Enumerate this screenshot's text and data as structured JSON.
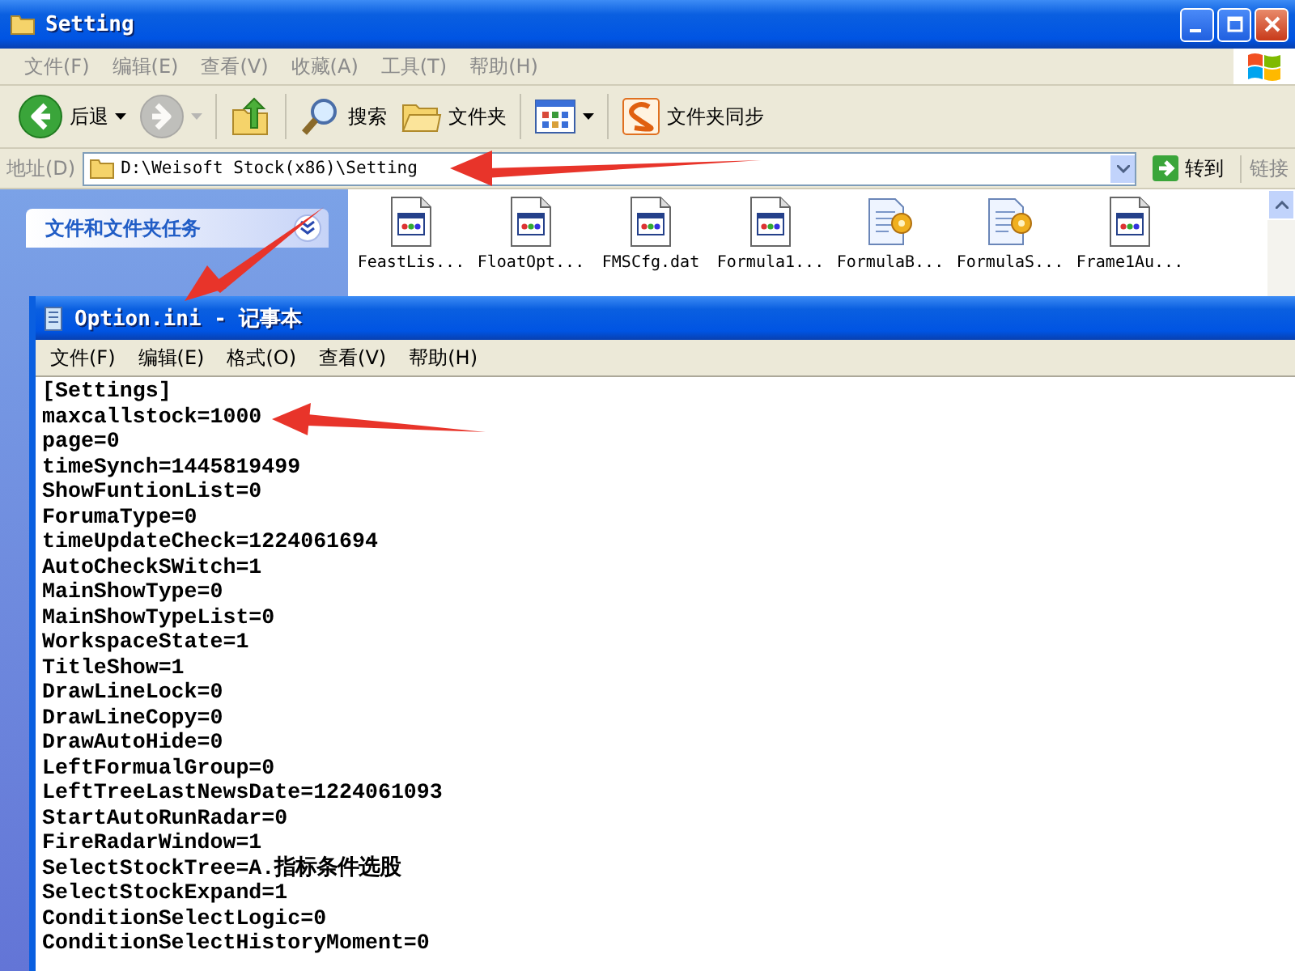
{
  "explorer": {
    "title": "Setting",
    "menu": [
      "文件(F)",
      "编辑(E)",
      "查看(V)",
      "收藏(A)",
      "工具(T)",
      "帮助(H)"
    ],
    "toolbar": [
      {
        "kind": "back",
        "label": "后退",
        "disabled": false,
        "dropdown": true
      },
      {
        "kind": "forward",
        "disabled": true,
        "dropdown": true
      },
      {
        "kind": "up",
        "disabled": false,
        "dropdown": false
      },
      {
        "kind": "search",
        "label": "搜索",
        "disabled": false,
        "dropdown": false
      },
      {
        "kind": "folders",
        "label": "文件夹",
        "disabled": false,
        "dropdown": false
      },
      {
        "kind": "views",
        "disabled": false,
        "dropdown": true
      },
      {
        "kind": "sync",
        "label": "文件夹同步",
        "disabled": false,
        "dropdown": false
      }
    ],
    "address": {
      "label": "地址(D)",
      "value": "D:\\Weisoft Stock(x86)\\Setting",
      "go": "转到",
      "links": "链接"
    },
    "tasks": [
      {
        "title": "文件和文件夹任务",
        "expanded": false
      }
    ],
    "files": [
      {
        "name": "FeastLis...",
        "kind": "app"
      },
      {
        "name": "FloatOpt...",
        "kind": "app"
      },
      {
        "name": "FMSCfg.dat",
        "kind": "app"
      },
      {
        "name": "Formula1...",
        "kind": "app"
      },
      {
        "name": "FormulaB...",
        "kind": "config"
      },
      {
        "name": "FormulaS...",
        "kind": "config"
      },
      {
        "name": "Frame1Au...",
        "kind": "app"
      }
    ]
  },
  "notepad": {
    "title": "Option.ini - 记事本",
    "menu": [
      "文件(F)",
      "编辑(E)",
      "格式(O)",
      "查看(V)",
      "帮助(H)"
    ],
    "lines": [
      "[Settings]",
      "maxcallstock=1000",
      "page=0",
      "timeSynch=1445819499",
      "ShowFuntionList=0",
      "ForumaType=0",
      "timeUpdateCheck=1224061694",
      "AutoCheckSWitch=1",
      "MainShowType=0",
      "MainShowTypeList=0",
      "WorkspaceState=1",
      "TitleShow=1",
      "DrawLineLock=0",
      "DrawLineCopy=0",
      "DrawAutoHide=0",
      "LeftFormualGroup=0",
      "LeftTreeLastNewsDate=1224061093",
      "StartAutoRunRadar=0",
      "FireRadarWindow=1",
      "SelectStockTree=A.指标条件选股",
      "SelectStockExpand=1",
      "ConditionSelectLogic=0",
      "ConditionSelectHistoryMoment=0"
    ]
  }
}
